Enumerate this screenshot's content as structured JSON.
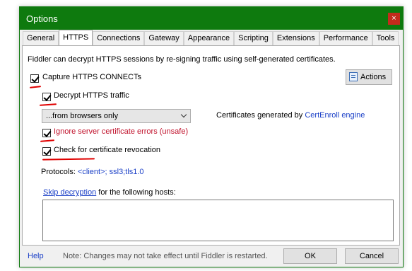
{
  "window": {
    "title": "Options",
    "close_glyph": "×"
  },
  "tabs": [
    {
      "label": "General",
      "active": false
    },
    {
      "label": "HTTPS",
      "active": true
    },
    {
      "label": "Connections",
      "active": false
    },
    {
      "label": "Gateway",
      "active": false
    },
    {
      "label": "Appearance",
      "active": false
    },
    {
      "label": "Scripting",
      "active": false
    },
    {
      "label": "Extensions",
      "active": false
    },
    {
      "label": "Performance",
      "active": false
    },
    {
      "label": "Tools",
      "active": false
    }
  ],
  "https": {
    "intro": "Fiddler can decrypt HTTPS sessions by re-signing traffic using self-generated certificates.",
    "capture_label": "Capture HTTPS CONNECTs",
    "capture_checked": true,
    "decrypt_label": "Decrypt HTTPS traffic",
    "decrypt_checked": true,
    "source_select": "...from browsers only",
    "certs_prefix": "Certificates generated by",
    "certs_engine": "CertEnroll engine",
    "ignore_label": "Ignore server certificate errors (unsafe)",
    "ignore_checked": true,
    "revocation_label": "Check for certificate revocation",
    "revocation_checked": true,
    "protocols_prefix": "Protocols:",
    "protocols_value": "<client>; ssl3;tls1.0",
    "skip_link": "Skip decryption",
    "skip_suffix": "for the following hosts:",
    "hosts_value": "",
    "actions_label": "Actions"
  },
  "footer": {
    "help": "Help",
    "note": "Note: Changes may not take effect until Fiddler is restarted.",
    "ok": "OK",
    "cancel": "Cancel"
  },
  "colors": {
    "titlebar": "#0e7a0e",
    "link": "#1a3fc7",
    "warning_text": "#c0102a",
    "annotation": "#e00000"
  }
}
